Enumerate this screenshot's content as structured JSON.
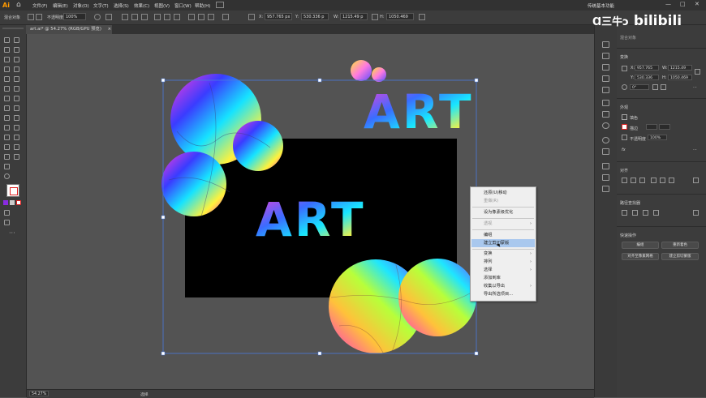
{
  "app": {
    "logo": "Ai",
    "home_icon": "home-icon",
    "workspace": "传统基本功能"
  },
  "menu": [
    "文件(F)",
    "编辑(E)",
    "对象(O)",
    "文字(T)",
    "选择(S)",
    "效果(C)",
    "视图(V)",
    "窗口(W)",
    "帮助(H)"
  ],
  "window_controls": [
    "—",
    "□",
    "✕"
  ],
  "controlbar": {
    "selection_label": "混合对象",
    "opacity_label": "不透明度",
    "opacity_value": "100%",
    "x_value": "957.765 px",
    "y_value": "530.336 p",
    "w_value": "1215.49 p",
    "h_value": "1050.469"
  },
  "document": {
    "tab": "art.ai* @ 54.27% (RGB/GPU 预览)",
    "close": "×"
  },
  "context_menu": {
    "items": [
      {
        "label": "还原(U)移动",
        "disabled": false,
        "submenu": false
      },
      {
        "label": "重做(R)",
        "disabled": true,
        "submenu": false
      },
      {
        "label": "透视",
        "disabled": true,
        "submenu": true
      },
      {
        "label": "设为像素级优化",
        "disabled": false,
        "submenu": false
      },
      {
        "label": "编组",
        "disabled": false,
        "submenu": false
      },
      {
        "label": "建立剪切蒙版",
        "disabled": false,
        "submenu": false,
        "highlighted": true
      },
      {
        "label": "变换",
        "disabled": false,
        "submenu": true
      },
      {
        "label": "排列",
        "disabled": false,
        "submenu": true
      },
      {
        "label": "选择",
        "disabled": false,
        "submenu": true
      },
      {
        "label": "添加到库",
        "disabled": false,
        "submenu": false
      },
      {
        "label": "收集以导出",
        "disabled": false,
        "submenu": true
      },
      {
        "label": "导出所选项目...",
        "disabled": false,
        "submenu": false
      }
    ]
  },
  "artwork": {
    "top_text": "ART",
    "center_text": "ART",
    "artboard_color": "#000000"
  },
  "panel": {
    "section_transform": "变换",
    "x": "957.765",
    "y": "530.336",
    "w": "1215.49",
    "h": "1050.469",
    "angle": "0°",
    "section_appearance": "外观",
    "stroke_label": "描边",
    "opacity_label": "不透明度",
    "fx": "fx",
    "section_align": "对齐",
    "section_pathfinder": "路径查找器",
    "section_quick": "快速操作",
    "btn_edit": "编组",
    "btn_recolor": "重新着色",
    "btn_expand": "对齐至像素网格",
    "btn_more": "建立剪切蒙版"
  },
  "status": {
    "zoom": "54.27%",
    "tool": "选择"
  },
  "watermark": {
    "left": "Ɑ三牛ᴐ",
    "right": "bilibili"
  },
  "colors": {
    "accent": "#a9c8ee",
    "artboard": "#000000",
    "ui_dark": "#323232"
  }
}
